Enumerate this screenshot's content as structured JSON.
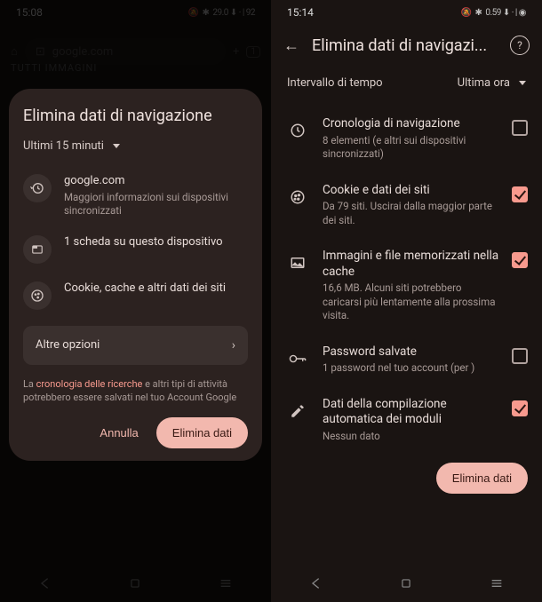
{
  "left": {
    "status_time": "15:08",
    "status_right": "29.0 ⬇︎ · | 92",
    "omnibox": "google.com",
    "tabs_ghost": "TUTTI   IMMAGINI",
    "modal": {
      "title": "Elimina dati di navigazione",
      "time_range": "Ultimi 15 minuti",
      "site": {
        "domain": "google.com",
        "sub": "Maggiori informazioni sui dispositivi sincronizzati"
      },
      "tab_row": "1 scheda su questo dispositivo",
      "cookie_row": "Cookie, cache e altri dati dei siti",
      "more_options": "Altre opzioni",
      "disclaimer_hl": "cronologia delle ricerche",
      "disclaimer_rest": " e altri tipi di attività potrebbero essere salvati nel tuo Account Google",
      "disclaimer_pre": "La ",
      "cancel": "Annulla",
      "confirm": "Elimina dati"
    }
  },
  "right": {
    "status_time": "15:14",
    "status_right": "0.59 ⬇︎ · | ◉",
    "appbar_title": "Elimina dati di navigazi...",
    "time_row_label": "Intervallo di tempo",
    "time_row_value": "Ultima ora",
    "items": [
      {
        "title": "Cronologia di navigazione",
        "sub": "8 elementi (e altri sui dispositivi sincronizzati)",
        "checked": false,
        "icon": "clock"
      },
      {
        "title": "Cookie e dati dei siti",
        "sub": "Da 79 siti. Uscirai dalla maggior parte dei siti.",
        "checked": true,
        "icon": "cookie"
      },
      {
        "title": "Immagini e file memorizzati nella cache",
        "sub": "16,6 MB. Alcuni siti potrebbero caricarsi più lentamente alla prossima visita.",
        "checked": true,
        "icon": "image"
      },
      {
        "title": "Password salvate",
        "sub": "1 password nel tuo account (per )",
        "checked": false,
        "icon": "key"
      },
      {
        "title": "Dati della compilazione automatica dei moduli",
        "sub": "Nessun dato",
        "checked": true,
        "icon": "edit"
      }
    ],
    "confirm": "Elimina dati"
  }
}
